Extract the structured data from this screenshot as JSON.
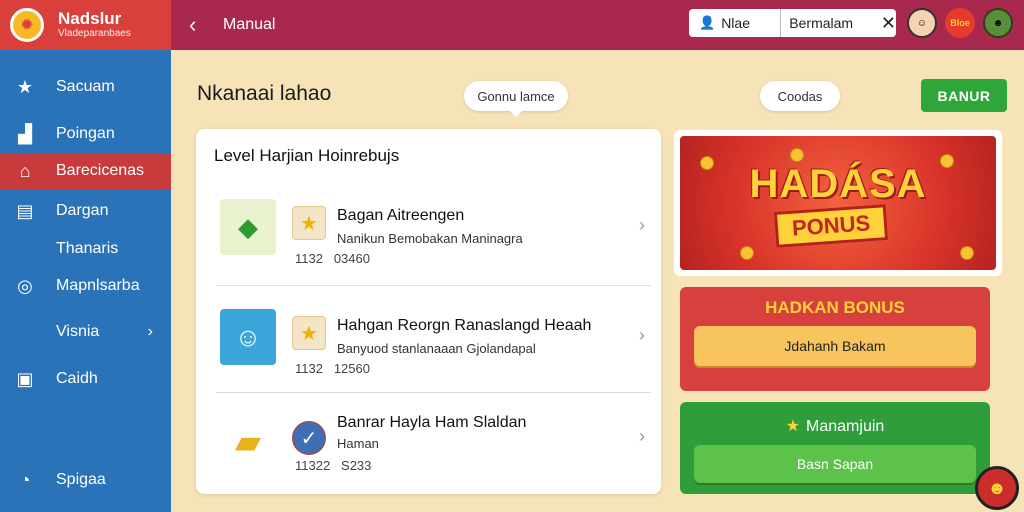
{
  "brand": {
    "title": "Nadslur",
    "subtitle": "Vladeparanbaes",
    "logo_icon": "logo-icon"
  },
  "sidebar": {
    "items": [
      {
        "label": "Sacuam",
        "icon": "star-icon"
      },
      {
        "label": "Poingan",
        "icon": "bar-chart-icon"
      },
      {
        "label": "Barecicenas",
        "icon": "store-icon",
        "active": true
      },
      {
        "label": "Dargan",
        "icon": "card-icon"
      },
      {
        "label": "Thanaris",
        "icon": ""
      },
      {
        "label": "Mapnlsarba",
        "icon": "compass-icon"
      },
      {
        "label": "Visnia",
        "icon": "",
        "chevron": "›"
      },
      {
        "label": "Caidh",
        "icon": "wallet-icon"
      },
      {
        "label": "Spigaa",
        "icon": "clock-icon"
      }
    ]
  },
  "topbar": {
    "back_icon": "‹",
    "title": "Manual",
    "user": {
      "name": "Nlae",
      "status": "Bermalam",
      "close": "✕"
    },
    "avatars": [
      "",
      "Bloe",
      ""
    ]
  },
  "header": {
    "page_title": "Nkanaai lahao",
    "pill_1": "Gonnu lamce",
    "pill_2": "Coodas",
    "action_button": "BANUR"
  },
  "list": {
    "title": "Level Harjian Hoinrebujs",
    "rows": [
      {
        "title": "Bagan Aitreengen",
        "subtitle": "Nanikun Bemobakan Maninagra",
        "meta_a": "1132",
        "meta_b": "03460",
        "thumb_icon": "green-ticket-icon"
      },
      {
        "title": "Hahgan Reorgn Ranaslangd Heaah",
        "subtitle": "Banyuod stanlanaaan Gjolandapal",
        "meta_a": "1132",
        "meta_b": "12560",
        "thumb_icon": "person-portrait-icon"
      },
      {
        "title": "Banrar Hayla Ham Slaldan",
        "subtitle": "Haman",
        "meta_a": "11322",
        "meta_b": "S233",
        "thumb_icon": "gold-bars-icon"
      }
    ]
  },
  "promo": {
    "banner_title": "HADÁSA",
    "banner_sub": "PONUS",
    "red_card": {
      "title": "HADKAN BONUS",
      "button": "Jdahanh Bakam"
    },
    "green_card": {
      "title": "Manamjuin",
      "button": "Basn Sapan"
    }
  },
  "colors": {
    "sidebar": "#2a73b8",
    "topbar": "#a8284e",
    "active": "#c93a3d",
    "green": "#2ea63a",
    "gold": "#ffd23a"
  }
}
